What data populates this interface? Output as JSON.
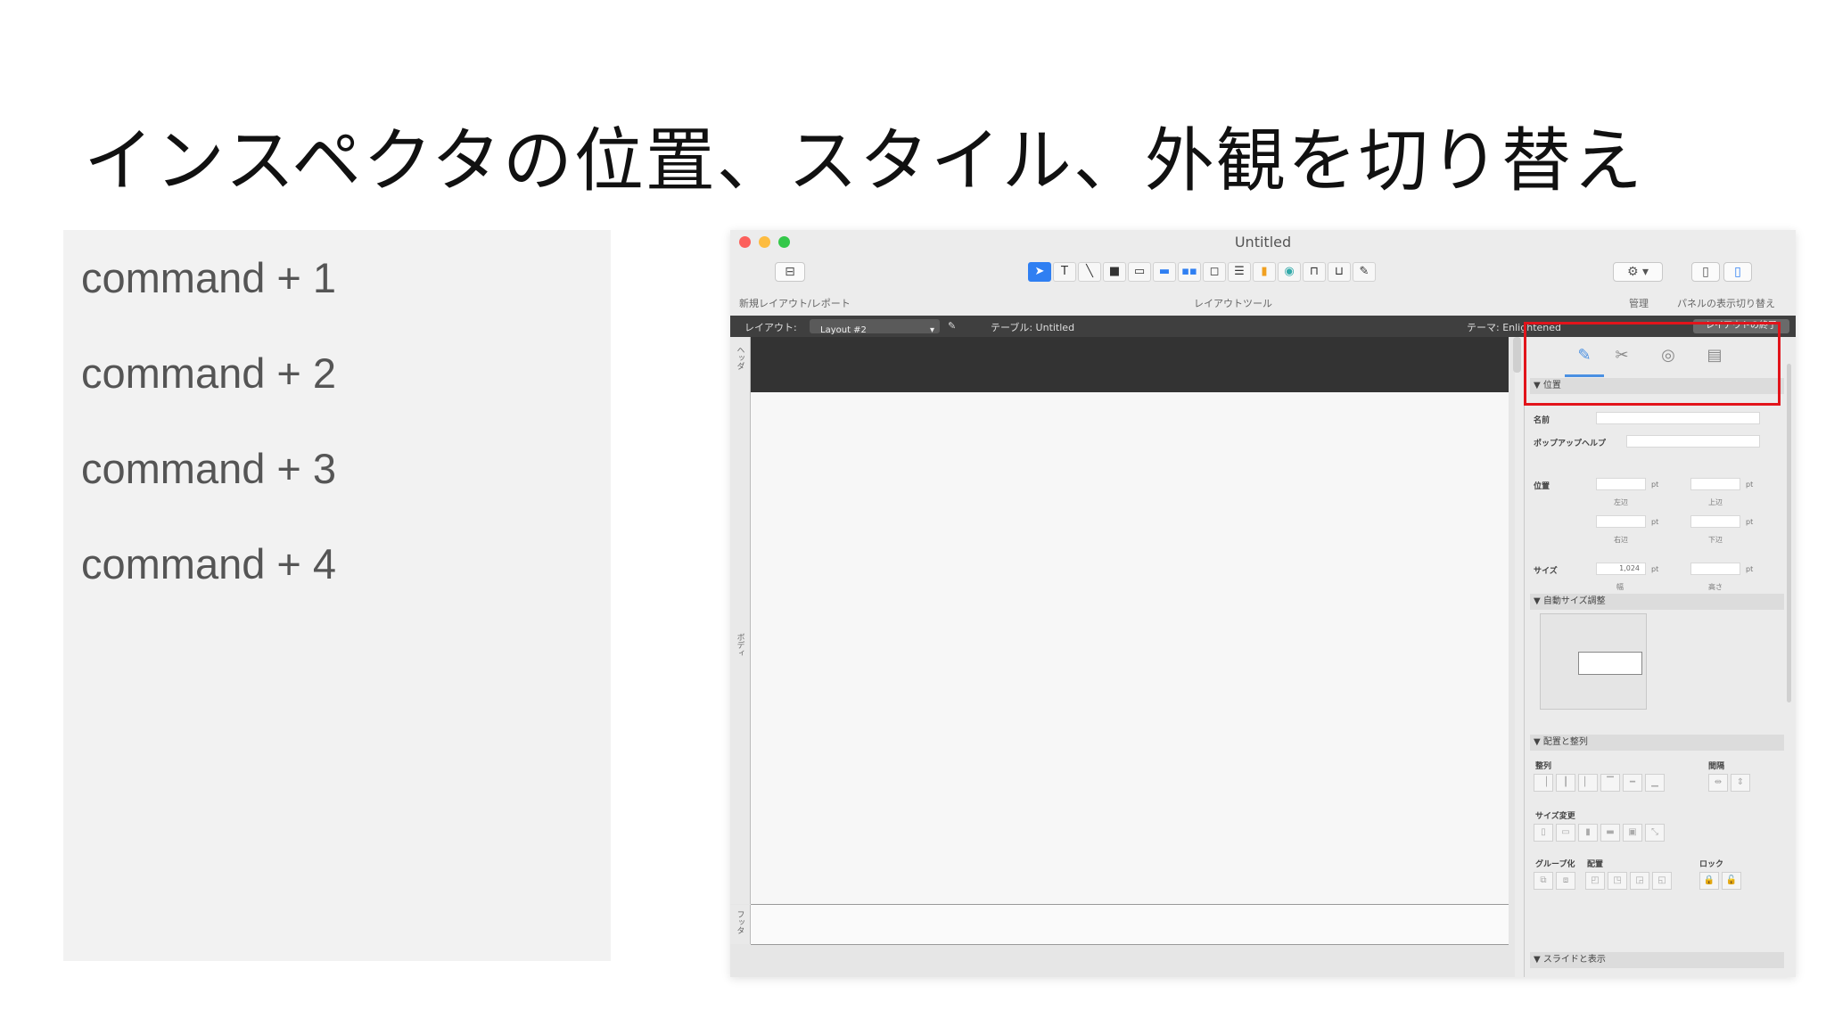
{
  "slide": {
    "title": "インスペクタの位置、スタイル、外観を切り替え",
    "commands": [
      "command + 1",
      "command + 2",
      "command + 3",
      "command + 4"
    ]
  },
  "window": {
    "title": "Untitled",
    "toolbar": {
      "new_layout_label": "新規レイアウト/レポート",
      "layout_tools_label": "レイアウトツール",
      "manage_label": "管理",
      "panel_toggle_label": "パネルの表示切り替え",
      "tool_icons": [
        "pointer-icon",
        "text-tool-icon",
        "line-tool-icon",
        "rect-tool-icon",
        "field-tool-icon",
        "button-tool-icon",
        "button-bar-tool-icon",
        "popover-tool-icon",
        "portal-tool-icon",
        "chart-tool-icon",
        "web-viewer-tool-icon",
        "tab-control-tool-icon",
        "slide-control-tool-icon",
        "format-painter-icon"
      ]
    },
    "layout_bar": {
      "layout_label": "レイアウト:",
      "layout_value": "Layout #2",
      "table_label": "テーブル: Untitled",
      "theme_label": "テーマ: Enlightened",
      "exit_button": "レイアウトの終了"
    },
    "parts": {
      "header": "ヘッダ",
      "body": "ボディ",
      "footer": "フッタ"
    },
    "inspector": {
      "tabs": [
        "position-tab-icon",
        "styles-tab-icon",
        "appearance-tab-icon",
        "data-tab-icon"
      ],
      "position_section": "▼ 位置",
      "name_label": "名前",
      "tooltip_label": "ポップアップヘルプ",
      "position_label": "位置",
      "sub_left": "左辺",
      "sub_top": "上辺",
      "sub_right": "右辺",
      "sub_bottom": "下辺",
      "size_label": "サイズ",
      "size_width_value": "1,024",
      "sub_width": "幅",
      "sub_height": "高さ",
      "unit": "pt",
      "autosize_section": "▼ 自動サイズ調整",
      "arrange_section": "▼ 配置と整列",
      "align_label": "整列",
      "distribute_label": "間隔",
      "resize_label": "サイズ変更",
      "group_label": "グループ化",
      "arrange_label": "配置",
      "lock_label": "ロック",
      "sliding_section": "▼ スライドと表示"
    }
  },
  "colors": {
    "highlight": "#e2141b",
    "close": "#fc605c",
    "minimize": "#fdbc40",
    "zoom": "#34c84a",
    "tool_active": "#2f7ff2"
  }
}
